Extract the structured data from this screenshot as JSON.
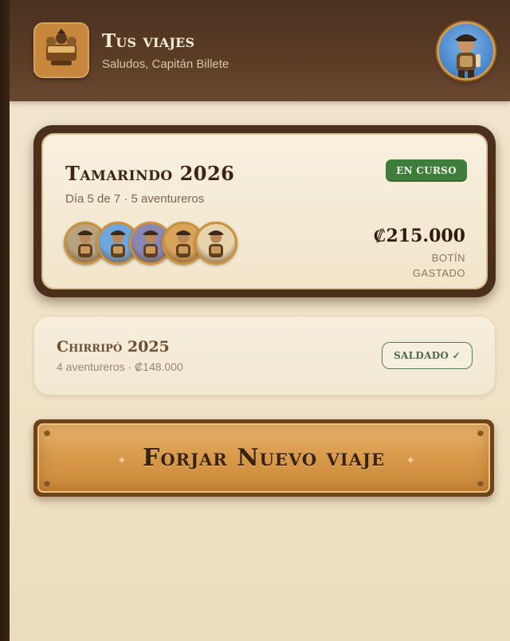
{
  "header": {
    "title": "Tus viajes",
    "subtitle": "Saludos, Capitán Billete",
    "logo_icon": "pirate-crew-logo",
    "avatar_icon": "pirate-captain-avatar"
  },
  "trips": {
    "active": {
      "title": "Tamarindo 2026",
      "meta": "Día 5 de 7 · 5 aventureros",
      "status": "EN CURSO",
      "amount": "₡215.000",
      "amount_label_line1": "BOTÍN",
      "amount_label_line2": "GASTADO",
      "crew_count": 5,
      "crew_colors": [
        "#b9a37e",
        "#6fa7dc",
        "#8a86b6",
        "#d9a45a",
        "#e8d3ad"
      ]
    },
    "settled": {
      "title": "Chirripó 2025",
      "meta": "4 aventureros · ₡148.000",
      "status": "SALDADO ✓"
    }
  },
  "actions": {
    "forge_label": "Forjar Nuevo viaje"
  },
  "colors": {
    "header_brown": "#5a3c26",
    "status_green": "#3e7d3b",
    "settled_green": "#4e6a47",
    "button_gold": "#d99b4c",
    "parchment": "#f1e6cf"
  }
}
